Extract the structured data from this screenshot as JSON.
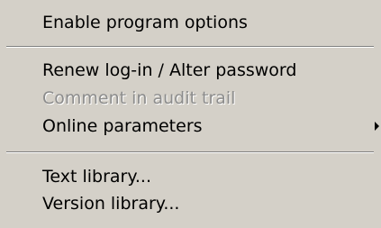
{
  "menu": {
    "items": [
      {
        "label": "Enable program options"
      },
      {
        "label": "Renew log-in / Alter password"
      },
      {
        "label": "Comment in audit trail"
      },
      {
        "label": "Online parameters"
      },
      {
        "label": "Text library..."
      },
      {
        "label": "Version library..."
      }
    ],
    "submenu_icon": "chevron-right-icon",
    "colors": {
      "background": "#d4d0c8",
      "text": "#000000",
      "disabled_text": "#8c8c8c"
    }
  }
}
